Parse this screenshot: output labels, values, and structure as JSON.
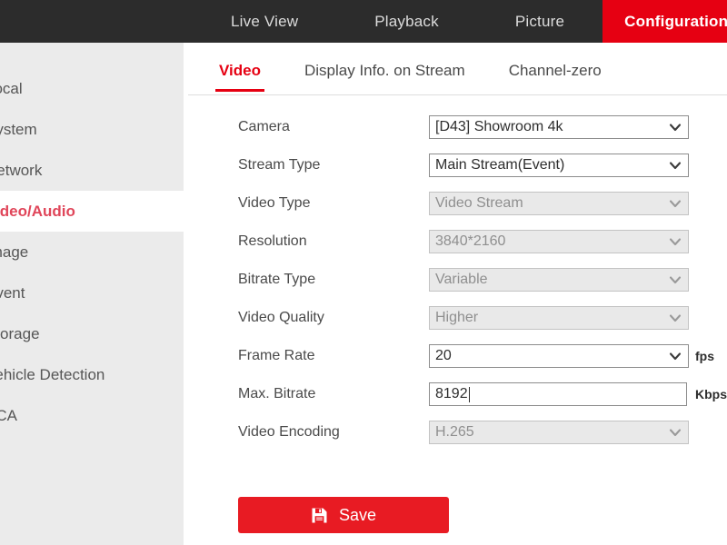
{
  "topnav": {
    "items": [
      {
        "label": "Live View",
        "active": false
      },
      {
        "label": "Playback",
        "active": false
      },
      {
        "label": "Picture",
        "active": false
      },
      {
        "label": "Configuration",
        "active": true
      }
    ]
  },
  "sidebar": {
    "items": [
      {
        "label": "Local",
        "active": false
      },
      {
        "label": "System",
        "active": false
      },
      {
        "label": "Network",
        "active": false
      },
      {
        "label": "Video/Audio",
        "active": true
      },
      {
        "label": "Image",
        "active": false
      },
      {
        "label": "Event",
        "active": false
      },
      {
        "label": "Storage",
        "active": false
      },
      {
        "label": "Vehicle Detection",
        "active": false
      },
      {
        "label": "VCA",
        "active": false
      }
    ]
  },
  "tabs": [
    {
      "label": "Video",
      "active": true
    },
    {
      "label": "Display Info. on Stream",
      "active": false
    },
    {
      "label": "Channel-zero",
      "active": false
    }
  ],
  "form": {
    "rows": [
      {
        "label": "Camera",
        "value": "[D43] Showroom 4k",
        "control": "select",
        "disabled": false,
        "unit": ""
      },
      {
        "label": "Stream Type",
        "value": "Main Stream(Event)",
        "control": "select",
        "disabled": false,
        "unit": ""
      },
      {
        "label": "Video Type",
        "value": "Video Stream",
        "control": "select",
        "disabled": true,
        "unit": ""
      },
      {
        "label": "Resolution",
        "value": "3840*2160",
        "control": "select",
        "disabled": true,
        "unit": ""
      },
      {
        "label": "Bitrate Type",
        "value": "Variable",
        "control": "select",
        "disabled": true,
        "unit": ""
      },
      {
        "label": "Video Quality",
        "value": "Higher",
        "control": "select",
        "disabled": true,
        "unit": ""
      },
      {
        "label": "Frame Rate",
        "value": "20",
        "control": "select",
        "disabled": false,
        "unit": "fps"
      },
      {
        "label": "Max. Bitrate",
        "value": "8192",
        "control": "text",
        "disabled": false,
        "unit": "Kbps",
        "focused": true
      },
      {
        "label": "Video Encoding",
        "value": "H.265",
        "control": "select",
        "disabled": true,
        "unit": ""
      }
    ]
  },
  "save": {
    "label": "Save",
    "icon": "save-floppy-icon"
  },
  "colors": {
    "brand_red": "#e60012",
    "button_red": "#e81b23",
    "header_dark": "#2c2c2c",
    "sidebar_gray": "#ebebeb",
    "active_link_red": "#e0465a",
    "disabled_field": "#e9e9e9"
  }
}
